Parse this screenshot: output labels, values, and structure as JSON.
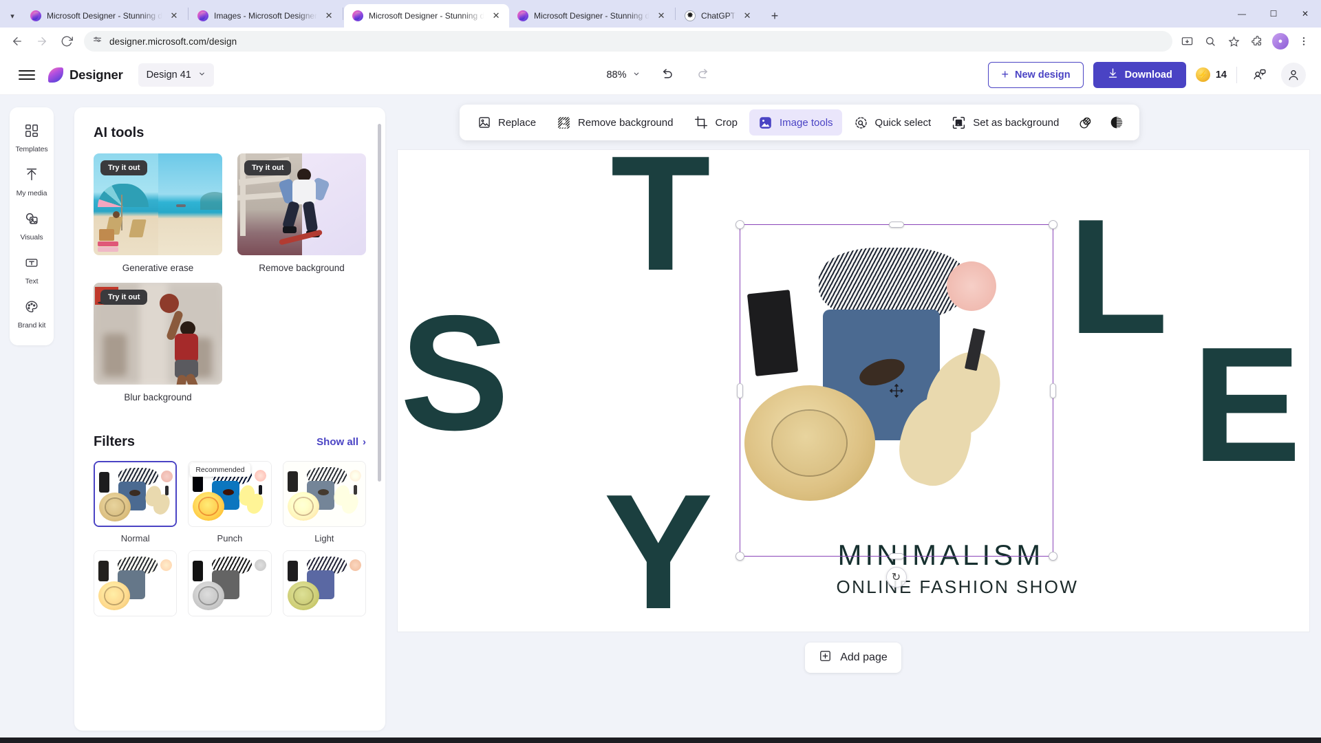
{
  "browser": {
    "tabs": [
      {
        "title": "Microsoft Designer - Stunning d",
        "favicon": "designer-favicon",
        "active": false
      },
      {
        "title": "Images - Microsoft Designer",
        "favicon": "designer-favicon",
        "active": false
      },
      {
        "title": "Microsoft Designer - Stunning d",
        "favicon": "designer-favicon",
        "active": true
      },
      {
        "title": "Microsoft Designer - Stunning d",
        "favicon": "designer-favicon",
        "active": false
      },
      {
        "title": "ChatGPT",
        "favicon": "chatgpt-favicon",
        "active": false
      }
    ],
    "new_tab_label": "+",
    "tab_close_label": "✕",
    "window_controls": {
      "minimize": "—",
      "maximize": "☐",
      "close": "✕"
    },
    "nav": {
      "back": "←",
      "forward": "→",
      "reload": "↻"
    },
    "url": "designer.microsoft.com/design",
    "toolbar_icons": [
      "install-icon",
      "zoom-icon",
      "bookmark-star-icon",
      "extensions-icon",
      "profile-avatar",
      "more-menu-icon"
    ]
  },
  "app_header": {
    "menu_label": "☰",
    "brand": "Designer",
    "design_name": "Design 41",
    "design_chevron": "⌄",
    "zoom_level": "88%",
    "zoom_chevron": "⌄",
    "undo_label": "Undo",
    "redo_label": "Redo",
    "new_design": "New design",
    "new_design_plus": "+",
    "download": "Download",
    "credits_count": "14",
    "share_label": "Share",
    "account_label": "Account"
  },
  "rail": {
    "items": [
      {
        "label": "Templates",
        "icon": "templates-icon"
      },
      {
        "label": "My media",
        "icon": "upload-arrow-icon"
      },
      {
        "label": "Visuals",
        "icon": "visuals-image-icon"
      },
      {
        "label": "Text",
        "icon": "text-box-icon"
      },
      {
        "label": "Brand kit",
        "icon": "palette-icon"
      }
    ]
  },
  "panel": {
    "ai_tools_title": "AI tools",
    "try_it_out": "Try it out",
    "ai_tools": [
      {
        "label": "Generative erase",
        "art": "beach"
      },
      {
        "label": "Remove background",
        "art": "skater"
      },
      {
        "label": "Blur background",
        "art": "basketball"
      }
    ],
    "filters_title": "Filters",
    "show_all": "Show all",
    "show_all_chevron": "›",
    "recommended_badge": "Recommended",
    "filters": [
      {
        "label": "Normal",
        "selected": true,
        "recommended": false,
        "fx": ""
      },
      {
        "label": "Punch",
        "selected": false,
        "recommended": true,
        "fx": "f-punch"
      },
      {
        "label": "Light",
        "selected": false,
        "recommended": false,
        "fx": "f-light"
      },
      {
        "label": "",
        "selected": false,
        "recommended": false,
        "fx": "f-warm"
      },
      {
        "label": "",
        "selected": false,
        "recommended": false,
        "fx": "f-bw"
      },
      {
        "label": "",
        "selected": false,
        "recommended": false,
        "fx": "f-cool"
      }
    ]
  },
  "context_toolbar": {
    "items": [
      {
        "label": "Replace",
        "icon": "replace-image-icon",
        "active": false
      },
      {
        "label": "Remove background",
        "icon": "remove-background-icon",
        "active": false
      },
      {
        "label": "Crop",
        "icon": "crop-icon",
        "active": false
      },
      {
        "label": "Image tools",
        "icon": "image-tools-icon",
        "active": true
      },
      {
        "label": "Quick select",
        "icon": "quick-select-icon",
        "active": false
      },
      {
        "label": "Set as background",
        "icon": "set-as-background-icon",
        "active": false
      }
    ],
    "icon_only": [
      {
        "icon": "layers-transparency-icon"
      },
      {
        "icon": "contrast-circle-icon"
      }
    ]
  },
  "canvas": {
    "letters": [
      "S",
      "T",
      "Y",
      "L",
      "E"
    ],
    "headline": "MINIMALISM",
    "subhead": "ONLINE FASHION SHOW",
    "selected_object": "product-flatlay-photo",
    "rotate_icon": "↻",
    "add_page": "Add page",
    "add_page_plus": "+"
  },
  "colors": {
    "accent": "#4a43c4",
    "accent_soft": "#eae6fb",
    "design_text": "#1b3f3f",
    "selection": "#8a44b8",
    "tabbar": "#dee1f5",
    "workspace": "#f1f3f9"
  }
}
